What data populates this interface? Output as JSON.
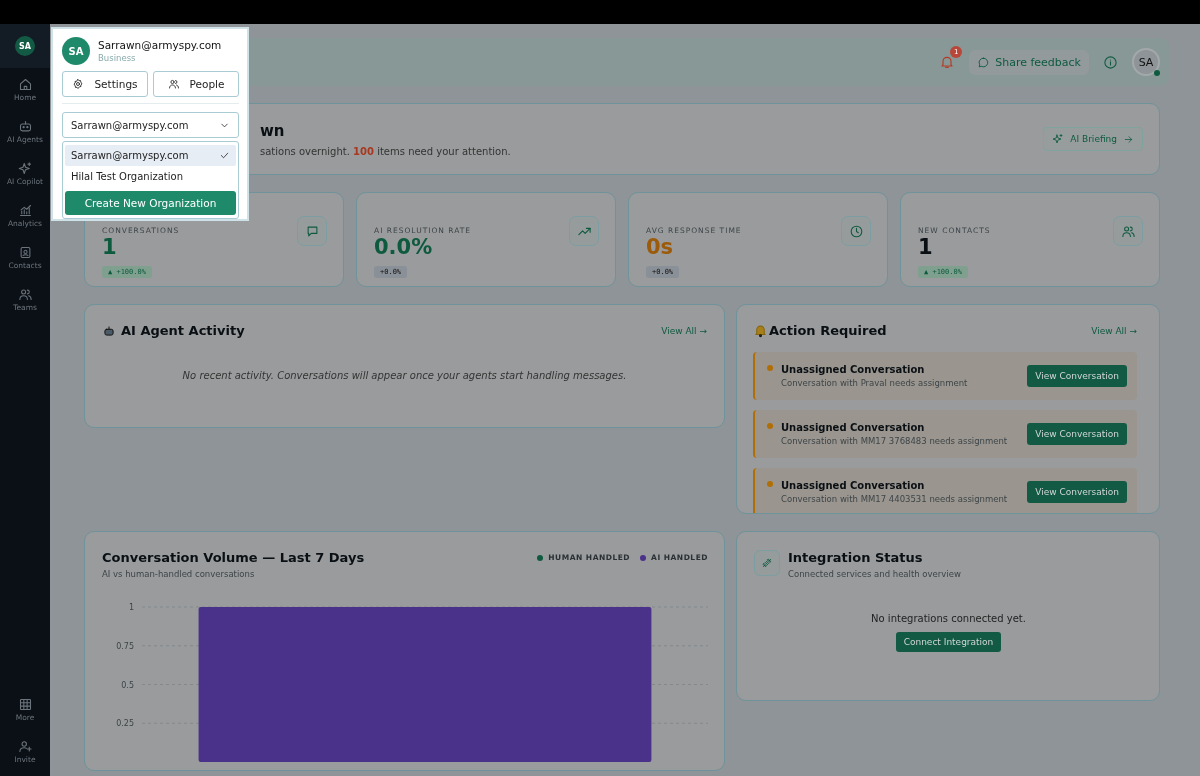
{
  "sidebar": {
    "avatar": "SA",
    "items": [
      {
        "label": "Home",
        "selected": false
      },
      {
        "label": "AI Agents",
        "selected": false
      },
      {
        "label": "AI Copilot",
        "selected": false
      },
      {
        "label": "Analytics",
        "selected": false
      },
      {
        "label": "Contacts",
        "selected": false
      },
      {
        "label": "Teams",
        "selected": false
      }
    ],
    "bottom_items": [
      {
        "label": "More",
        "selected": false
      },
      {
        "label": "Invite",
        "selected": false
      }
    ]
  },
  "header": {
    "notification_count": "1",
    "feedback": "Share feedback",
    "avatar": "SA"
  },
  "welcome": {
    "title": "wn",
    "subtitle": "sations overnight. **100** items need your attention.",
    "briefing_button": "AI Briefing"
  },
  "stats": [
    {
      "label": "CONVERSATIONS",
      "value": "1",
      "color": "#0e5a3f",
      "change": "▲ +100.0%",
      "kind": "up"
    },
    {
      "label": "AI RESOLUTION RATE",
      "value": "0.0%",
      "color": "#0e5a3f",
      "change": "+0.0%",
      "kind": "neutral"
    },
    {
      "label": "AVG RESPONSE TIME",
      "value": "0s",
      "color": "#9c5a0b",
      "change": "+0.0%",
      "kind": "neutral"
    },
    {
      "label": "NEW CONTACTS",
      "value": "1",
      "color": "#0a0f14",
      "change": "▲ +100.0%",
      "kind": "up"
    }
  ],
  "agent_activity": {
    "title": "AI Agent Activity",
    "view_all": "View All →",
    "empty": "No recent activity. Conversations will appear once your agents start handling messages."
  },
  "action_required": {
    "title": "Action Required",
    "view_all": "View All →",
    "items": [
      {
        "title": "Unassigned Conversation",
        "detail": "Conversation with Praval needs assignment",
        "button": "View Conversation",
        "color": "#b06e05"
      },
      {
        "title": "Unassigned Conversation",
        "detail": "Conversation with MM17 3768483 needs assignment",
        "button": "View Conversation",
        "color": "#b06e05"
      },
      {
        "title": "Unassigned Conversation",
        "detail": "Conversation with MM17 4403531 needs assignment",
        "button": "View Conversation",
        "color": "#b06e05"
      }
    ]
  },
  "volume": {
    "title": "Conversation Volume — Last 7 Days",
    "subtitle": "AI vs human-handled conversations",
    "chart_data": {
      "type": "bar",
      "stacked": true,
      "grid": true,
      "ylim": [
        0,
        1
      ],
      "yticks": [
        0.25,
        0.5,
        0.75,
        1
      ],
      "series": [
        {
          "name": "HUMAN HANDLED",
          "color": "#0e5a3f",
          "values": [
            0
          ]
        },
        {
          "name": "AI HANDLED",
          "color": "#4a318a",
          "values": [
            1
          ]
        }
      ]
    }
  },
  "integration": {
    "title": "Integration Status",
    "subtitle": "Connected services and health overview",
    "empty": "No integrations connected yet.",
    "button": "Connect Integration"
  },
  "account_menu": {
    "avatar": "SA",
    "email": "Sarrawn@armyspy.com",
    "plan": "Business",
    "buttons": [
      "Settings",
      "People"
    ],
    "org_select": {
      "value": "Sarrawn@armyspy.com",
      "expanded": true
    },
    "options": [
      {
        "label": "Sarrawn@armyspy.com",
        "selected": true
      },
      {
        "label": "Hilal Test Organization",
        "selected": false
      }
    ],
    "create_button": "Create New Organization"
  }
}
